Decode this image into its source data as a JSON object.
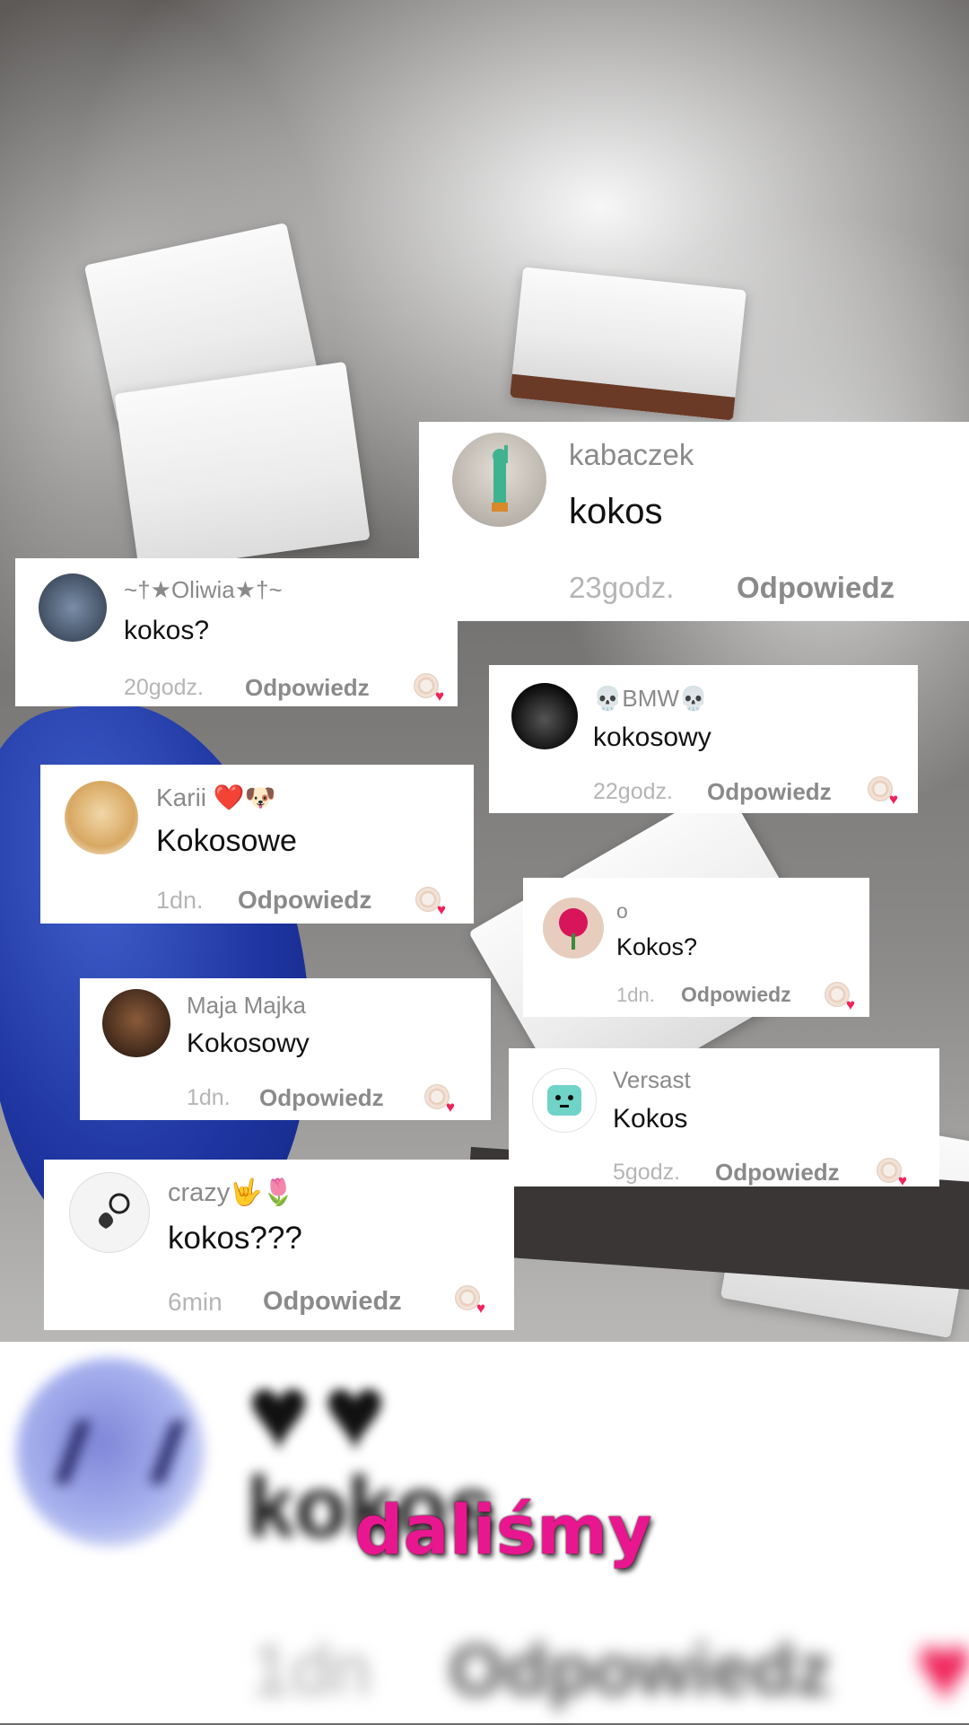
{
  "comments": [
    {
      "username": "kabaczek",
      "text": "kokos",
      "time": "23godz.",
      "reply": "Odpowiedz",
      "avatar": "statue-of-liberty-avatar"
    },
    {
      "username": "~†★Oliwia★†~",
      "text": "kokos?",
      "time": "20godz.",
      "reply": "Odpowiedz",
      "avatar": "car-avatar"
    },
    {
      "username": "💀BMW💀",
      "text": "kokosowy",
      "time": "22godz.",
      "reply": "Odpowiedz",
      "avatar": "black-car-avatar"
    },
    {
      "username": "Karii ❤️🐶",
      "text": "Kokosowe",
      "time": "1dn.",
      "reply": "Odpowiedz",
      "avatar": "puppy-avatar"
    },
    {
      "username": "o",
      "text": "Kokos?",
      "time": "1dn.",
      "reply": "Odpowiedz",
      "avatar": "pink-flower-avatar"
    },
    {
      "username": "Maja Majka",
      "text": "Kokosowy",
      "time": "1dn.",
      "reply": "Odpowiedz",
      "avatar": "dog-avatar"
    },
    {
      "username": "Versast",
      "text": "Kokos",
      "time": "5godz.",
      "reply": "Odpowiedz",
      "avatar": "cartoon-avatar"
    },
    {
      "username": "crazy🤟🌷",
      "text": "kokos???",
      "time": "6min",
      "reply": "Odpowiedz",
      "avatar": "sketch-avatar"
    }
  ],
  "overlay": {
    "caption": "dalismy_placeholder"
  },
  "colors": {
    "like_heart": "#f0225a",
    "caption_pink": "#e8178f"
  }
}
